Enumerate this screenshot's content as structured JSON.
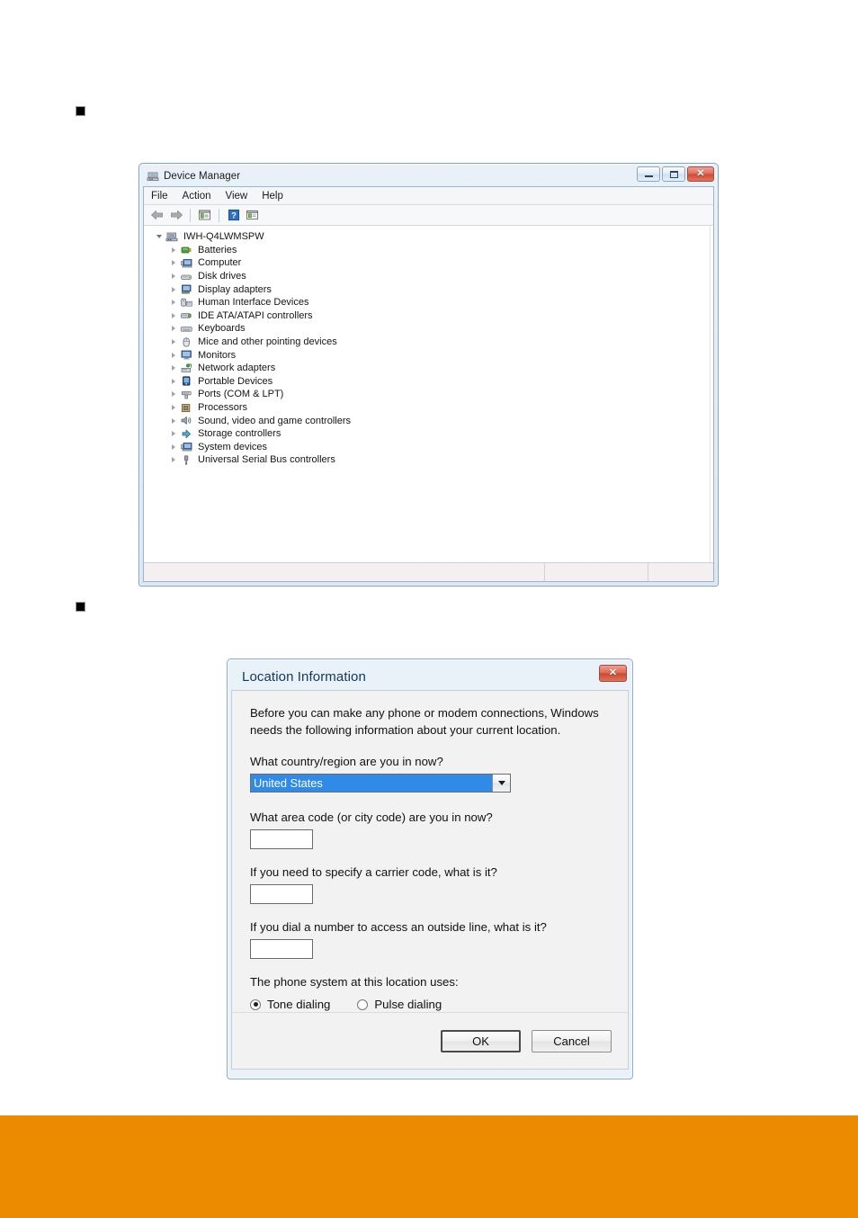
{
  "page": {
    "bullets": [
      {
        "name": "section-bullet-1"
      },
      {
        "name": "section-bullet-2"
      }
    ],
    "footer_band_color": "#ED8B00"
  },
  "device_manager": {
    "title": "Device Manager",
    "title_icon": "device-manager-icon",
    "window_buttons": {
      "minimize": "minimize-icon",
      "maximize": "maximize-icon",
      "close": "close-icon",
      "close_glyph": "✕"
    },
    "menu": [
      {
        "label": "File"
      },
      {
        "label": "Action"
      },
      {
        "label": "View"
      },
      {
        "label": "Help"
      }
    ],
    "toolbar": [
      {
        "name": "back-arrow-icon"
      },
      {
        "name": "forward-arrow-icon"
      },
      {
        "name": "separator"
      },
      {
        "name": "properties-icon"
      },
      {
        "name": "separator"
      },
      {
        "name": "help-icon"
      },
      {
        "name": "show-hidden-devices-icon"
      }
    ],
    "tree": {
      "root": {
        "label": "IWH-Q4LWMSPW",
        "expanded": true,
        "icon": "computer-root-icon"
      },
      "items": [
        {
          "label": "Batteries",
          "icon": "batteries-icon"
        },
        {
          "label": "Computer",
          "icon": "computer-icon"
        },
        {
          "label": "Disk drives",
          "icon": "disk-drive-icon"
        },
        {
          "label": "Display adapters",
          "icon": "display-adapter-icon"
        },
        {
          "label": "Human Interface Devices",
          "icon": "hid-icon"
        },
        {
          "label": "IDE ATA/ATAPI controllers",
          "icon": "ide-controller-icon"
        },
        {
          "label": "Keyboards",
          "icon": "keyboard-icon"
        },
        {
          "label": "Mice and other pointing devices",
          "icon": "mouse-icon"
        },
        {
          "label": "Monitors",
          "icon": "monitor-icon"
        },
        {
          "label": "Network adapters",
          "icon": "network-adapter-icon"
        },
        {
          "label": "Portable Devices",
          "icon": "portable-device-icon"
        },
        {
          "label": "Ports (COM & LPT)",
          "icon": "ports-icon"
        },
        {
          "label": "Processors",
          "icon": "processor-icon"
        },
        {
          "label": "Sound, video and game controllers",
          "icon": "sound-controller-icon"
        },
        {
          "label": "Storage controllers",
          "icon": "storage-controller-icon"
        },
        {
          "label": "System devices",
          "icon": "system-device-icon"
        },
        {
          "label": "Universal Serial Bus controllers",
          "icon": "usb-controller-icon"
        }
      ]
    },
    "status_bar": {
      "pane1": "",
      "pane2": "",
      "pane3": ""
    }
  },
  "location_dialog": {
    "title": "Location Information",
    "close_glyph": "✕",
    "close_icon": "close-icon",
    "intro": "Before you can make any phone or modem connections, Windows needs the following information about your current location.",
    "country": {
      "label": "What country/region are you in now?",
      "value": "United States",
      "caret_icon": "chevron-down-icon"
    },
    "area_code": {
      "label": "What area code (or city code) are you in now?",
      "value": "",
      "placeholder": ""
    },
    "carrier_code": {
      "label": "If you need to specify a carrier code, what is it?",
      "value": "",
      "placeholder": ""
    },
    "outside_line": {
      "label": "If you dial a number to access an outside line, what is it?",
      "value": "",
      "placeholder": ""
    },
    "phone_system": {
      "label": "The phone system at this location uses:",
      "options": [
        {
          "label": "Tone dialing",
          "selected": true
        },
        {
          "label": "Pulse dialing",
          "selected": false
        }
      ]
    },
    "buttons": {
      "ok": "OK",
      "cancel": "Cancel"
    }
  }
}
